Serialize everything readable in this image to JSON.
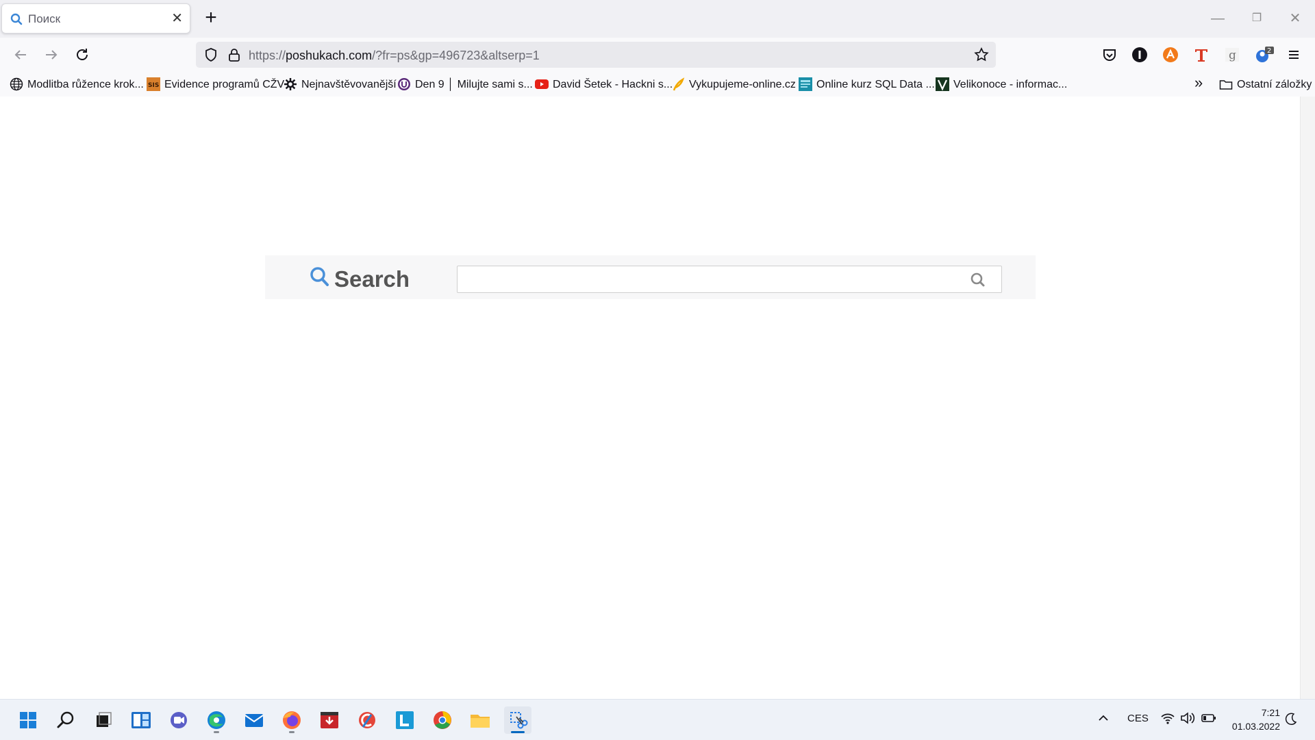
{
  "browser": {
    "tab": {
      "title": "Поиск",
      "close_glyph": "✕",
      "icon": "search-icon"
    },
    "new_tab_glyph": "+",
    "window_controls": {
      "minimize": "—",
      "restore": "❐",
      "close": "✕"
    },
    "url": {
      "scheme": "https://",
      "host": "poshukach.com",
      "path": "/?fr=ps&gp=496723&altserp=1"
    },
    "extension_badge": "2",
    "bookmarks": [
      {
        "label": "Modlitba růžence krok...",
        "icon": "globe-icon"
      },
      {
        "label": "Evidence programů CŽV",
        "icon": "sis-icon"
      },
      {
        "label": "Nejnavštěvovanější",
        "icon": "gear-icon"
      },
      {
        "label": "Den 9 │ Milujte sami s...",
        "icon": "u-icon"
      },
      {
        "label": "David Šetek - Hackni s...",
        "icon": "youtube-icon"
      },
      {
        "label": "Vykupujeme-online.cz",
        "icon": "feather-icon"
      },
      {
        "label": "Online kurz SQL Data ...",
        "icon": "course-icon"
      },
      {
        "label": "Velikonoce - informac...",
        "icon": "v-icon"
      }
    ],
    "bookmarks_overflow": "»",
    "other_bookmarks": "Ostatní záložky"
  },
  "page": {
    "search_brand": "Search",
    "search_placeholder": "",
    "accent": "#4a90d9"
  },
  "taskbar": {
    "language": "CES",
    "time": "7:21",
    "date": "01.03.2022"
  }
}
